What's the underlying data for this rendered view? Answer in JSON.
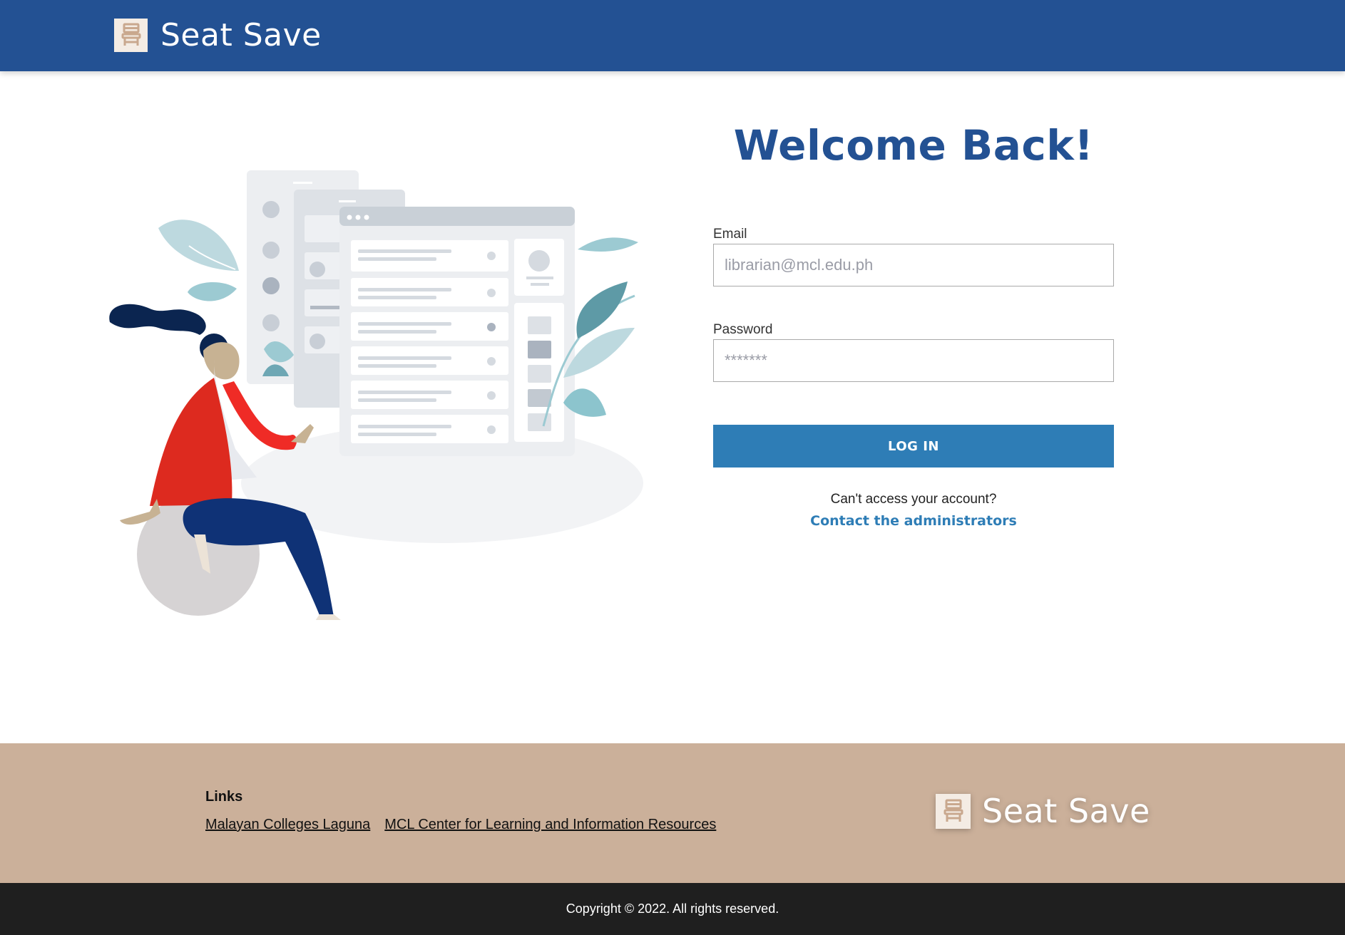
{
  "header": {
    "brand_name": "Seat Save",
    "logo_icon": "chair-icon"
  },
  "login": {
    "title": "Welcome Back!",
    "email_label": "Email",
    "email_placeholder": "librarian@mcl.edu.ph",
    "email_value": "",
    "password_label": "Password",
    "password_placeholder": "*******",
    "password_value": "",
    "submit_label": "LOG IN",
    "help_text": "Can't access your account?",
    "contact_link": "Contact the administrators"
  },
  "footer": {
    "links_heading": "Links",
    "links": [
      {
        "label": "Malayan Colleges Laguna"
      },
      {
        "label": "MCL Center for Learning and Information Resources"
      }
    ],
    "brand_name": "Seat Save",
    "copyright": "Copyright © 2022. All rights reserved."
  },
  "colors": {
    "header_bg": "#235193",
    "title": "#235193",
    "button": "#2e7db6",
    "link": "#2e7db6",
    "footer_bg": "#cbb09a",
    "copyright_bg": "#1f1f1f"
  }
}
